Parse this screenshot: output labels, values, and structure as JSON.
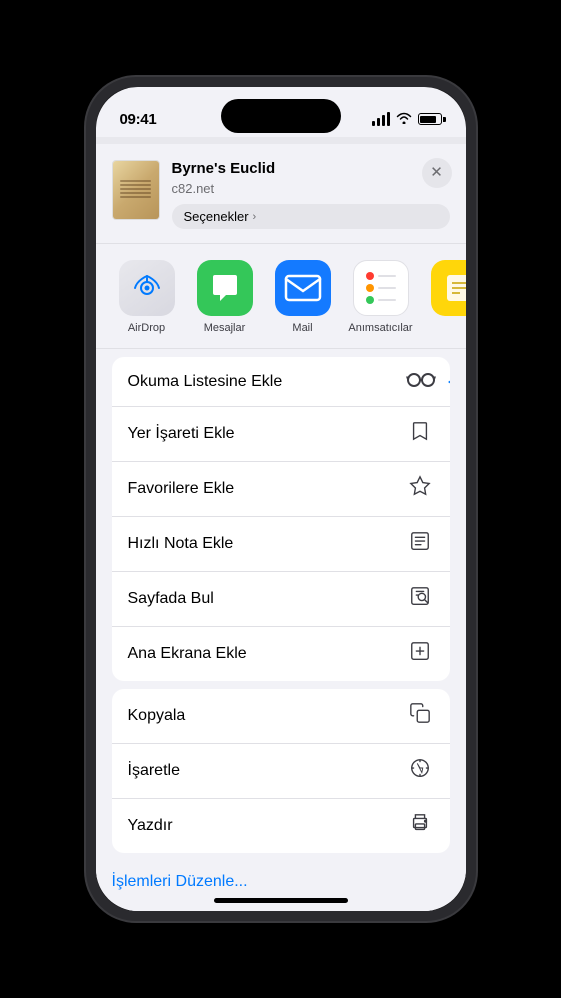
{
  "statusBar": {
    "time": "09:41",
    "batteryLevel": 85
  },
  "bookHeader": {
    "title": "Byrne's Euclid",
    "url": "c82.net",
    "optionsLabel": "Seçenekler",
    "closeLabel": "×"
  },
  "apps": [
    {
      "id": "airdrop",
      "label": "AirDrop",
      "type": "airdrop"
    },
    {
      "id": "messages",
      "label": "Mesajlar",
      "type": "messages"
    },
    {
      "id": "mail",
      "label": "Mail",
      "type": "mail"
    },
    {
      "id": "reminders",
      "label": "Anımsatıcılar",
      "type": "reminders"
    }
  ],
  "actions": [
    {
      "group": 1,
      "items": [
        {
          "id": "reading-list",
          "label": "Okuma Listesine Ekle",
          "icon": "glasses",
          "highlighted": true
        },
        {
          "id": "add-bookmark",
          "label": "Yer İşareti Ekle",
          "icon": "bookmark"
        },
        {
          "id": "add-favorites",
          "label": "Favorilere Ekle",
          "icon": "star"
        },
        {
          "id": "quick-note",
          "label": "Hızlı Nota Ekle",
          "icon": "note"
        },
        {
          "id": "find-page",
          "label": "Sayfada Bul",
          "icon": "find"
        },
        {
          "id": "add-home",
          "label": "Ana Ekrana Ekle",
          "icon": "plus-square"
        }
      ]
    },
    {
      "group": 2,
      "items": [
        {
          "id": "copy",
          "label": "Kopyala",
          "icon": "copy"
        },
        {
          "id": "mark",
          "label": "İşaretle",
          "icon": "compass"
        },
        {
          "id": "print",
          "label": "Yazdır",
          "icon": "print"
        }
      ]
    }
  ],
  "editActions": {
    "label": "İşlemleri Düzenle..."
  }
}
